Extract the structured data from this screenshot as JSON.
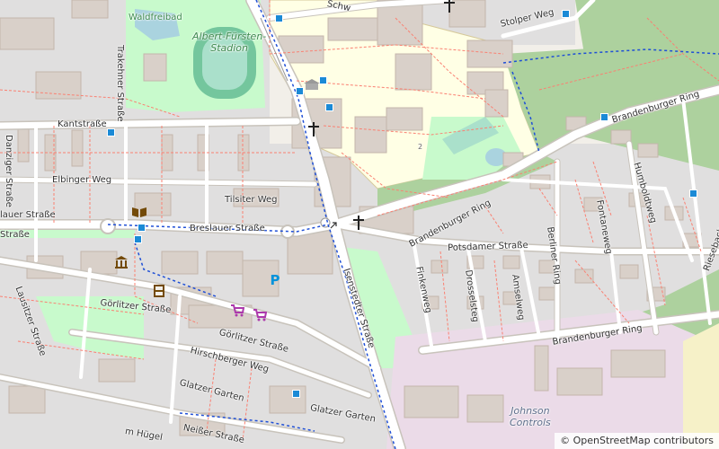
{
  "map": {
    "labels": {
      "schw": "Schw",
      "waldfreibad": "Waldfreibad",
      "stadion": "Albert-Fürsten-\nStadion",
      "stolper_weg": "Stolper Weg",
      "kantstrasse": "Kantstraße",
      "danziger_strasse": "Danziger Straße",
      "trakehner_strasse": "Trakehner Straße",
      "elbinger_weg": "Elbinger Weg",
      "tilsiter_weg": "Tilsiter Weg",
      "breslauer_strasse_w": "lauer Straße",
      "strasse_w": "Straße",
      "breslauer_strasse": "Breslauer Straße",
      "brandenburger_ring_ne": "Brandenburger Ring",
      "brandenburger_ring_mid": "Brandenburger Ring",
      "brandenburger_ring_s": "Brandenburger Ring",
      "humboldtweg": "Humboldtweg",
      "fontaneweg": "Fontaneweg",
      "berliner_ring": "Berliner Ring",
      "potsdamer_strasse": "Potsdamer Straße",
      "finkenweg": "Finkenweg",
      "drosselsteg": "Drosselsteg",
      "amselweg": "Amselweg",
      "isenstedter_strasse": "Isenstedter Straße",
      "lausitzer_strasse": "Lausitzer Straße",
      "goerlitzer_strasse_w": "Görlitzer Straße",
      "goerlitzer_strasse": "Görlitzer Straße",
      "hirschberger_weg": "Hirschberger Weg",
      "glatzer_garten": "Glatzer Garten",
      "neisser_strasse": "Neißer Straße",
      "glatzer_garten_s": "Glatzer Garten",
      "hugel": "m Hügel",
      "johnson_controls": "Johnson\nControls",
      "riesebach": "Riesebach",
      "number_2": "2"
    },
    "icons": {
      "church_north": "church-icon",
      "church_center": "church-icon",
      "church_east": "church-icon",
      "library": "library-icon",
      "museum": "museum-icon",
      "cinema": "cinema-icon",
      "shop_1": "shopping-cart-icon",
      "shop_2": "shopping-cart-icon",
      "parking": "parking-icon",
      "parking_letter": "P",
      "bus_stops": "bus-stop-icon"
    },
    "colors": {
      "background": "#f2efe9",
      "residential": "#e0dfdf",
      "building": "#d9d0c9",
      "park": "#c8facc",
      "forest": "#add19e",
      "school": "#ffffe5",
      "industrial": "#ebdbe8",
      "pitch": "#aae0cb",
      "water": "#aad3df",
      "road": "#ffffff",
      "road_casing": "#c8c3bb",
      "path": "#fa8072",
      "route": "#1f4fd6",
      "stop": "#1b8ad6"
    },
    "attribution": "© OpenStreetMap contributors"
  }
}
